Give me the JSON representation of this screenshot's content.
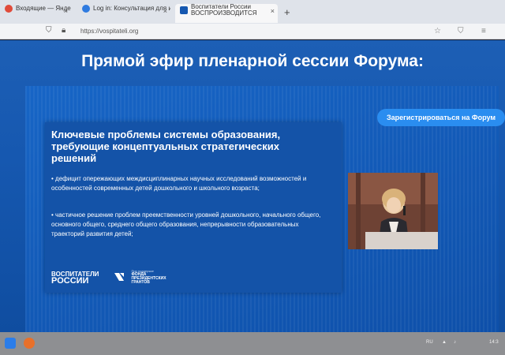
{
  "browser": {
    "tabs": [
      {
        "title": "Входящие — Яндекс Почта",
        "active": false
      },
      {
        "title": "Log in: Консультация для инн",
        "active": false
      },
      {
        "title": "Воспитатели России ВОСПРОИЗВОДИТСЯ",
        "active": true
      }
    ],
    "new_tab_symbol": "+",
    "close_symbol": "×",
    "url": "https://vospitateli.org"
  },
  "page": {
    "heading": "Прямой эфир пленарной сессии Форума:",
    "register_button": "Зарегистрироваться на Форум",
    "slide": {
      "title": "Ключевые проблемы системы образования, требующие концептуальных стратегических решений",
      "bullets": [
        "• дефицит опережающих междисциплинарных научных исследований возможностей и особенностей современных детей дошкольного и школьного возраста;",
        "• частичное решение проблем преемственности уровней дошкольного, начального общего, основного общего, среднего общего образования, непрерывности образовательных траекторий развития детей;"
      ],
      "logo_primary": {
        "line1": "ВОСПИТАТЕЛИ",
        "line2": "РОССИИ"
      },
      "logo_secondary": {
        "small": "При поддержке",
        "name_line1": "ФОНДА",
        "name_line2": "ПРЕЗИДЕНТСКИХ",
        "name_line3": "ГРАНТОВ"
      }
    }
  },
  "taskbar": {
    "lang": "RU",
    "time": "14:3"
  },
  "colors": {
    "accent": "#2a8df0",
    "page_bg": "#1658b0",
    "slide_bg": "#1453a8"
  }
}
